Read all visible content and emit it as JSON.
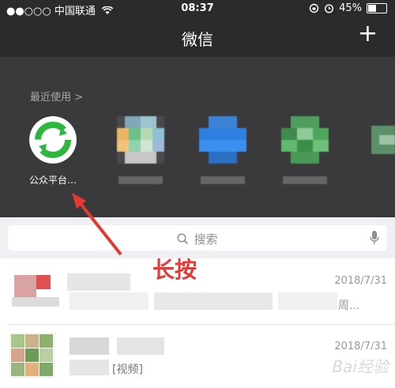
{
  "status_bar": {
    "signal": "●●○○○",
    "carrier": "中国联通",
    "time": "08:37",
    "battery_percent": "45%",
    "battery_level": 0.45
  },
  "nav": {
    "title": "微信",
    "add_label": "+"
  },
  "recent": {
    "label": "最近使用 >",
    "apps": [
      {
        "name": "公众平台…"
      }
    ]
  },
  "search": {
    "label": "搜索"
  },
  "chats": [
    {
      "date": "2018/7/31",
      "preview_tail": "周..."
    },
    {
      "date": "2018/7/31",
      "preview": "[视频]"
    }
  ],
  "annotation": {
    "text": "长按"
  },
  "watermark": {
    "text": "Bai经验"
  },
  "colors": {
    "nav_bg": "#2b2b2d",
    "drawer_bg": "#3a3a3d",
    "search_bg": "#efeff4",
    "accent_green": "#2db83d",
    "annotation_red": "#e53935"
  }
}
